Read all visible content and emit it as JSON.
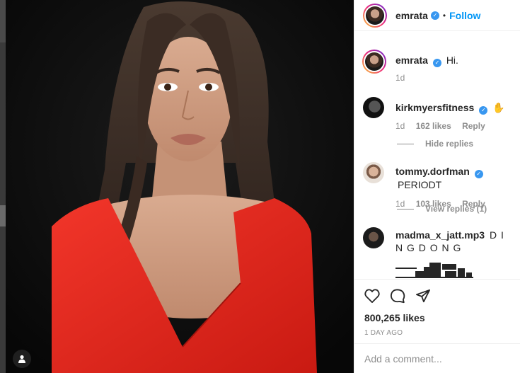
{
  "header": {
    "username": "emrata",
    "separator": "•",
    "follow_label": "Follow"
  },
  "caption": {
    "username": "emrata",
    "text": "Hi.",
    "age": "1d"
  },
  "comments": [
    {
      "username": "kirkmyersfitness",
      "text": "✋",
      "age": "1d",
      "likes": "162 likes",
      "reply": "Reply",
      "replies_toggle": "Hide replies"
    },
    {
      "username": "tommy.dorfman",
      "text": "PERIODT",
      "age": "1d",
      "likes": "103 likes",
      "reply": "Reply",
      "replies_toggle": "View replies (1)"
    },
    {
      "username": "madma_x_jatt.mp3",
      "text": "D I N G D O N G"
    }
  ],
  "actions": {
    "likes": "800,265 likes",
    "time": "1 day ago"
  },
  "add_comment": {
    "placeholder": "Add a comment..."
  },
  "icons": [
    "user-tag-icon",
    "verified-icon",
    "heart-icon",
    "comment-icon",
    "share-icon"
  ],
  "colors": {
    "accent": "#0095f6",
    "verified": "#3897f0",
    "dress": "#e3261b",
    "muted": "#8e8e8e"
  }
}
